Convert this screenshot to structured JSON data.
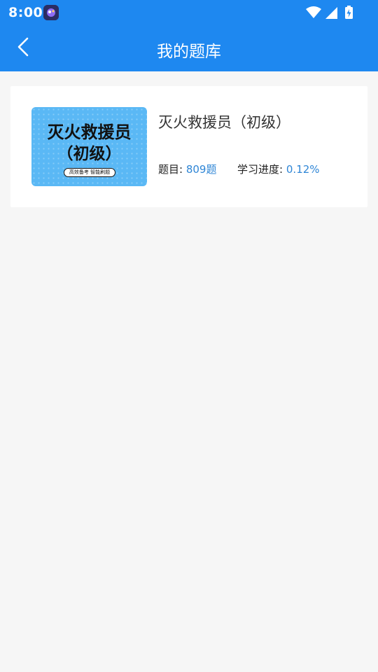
{
  "status_bar": {
    "time": "8:00",
    "icons": [
      "app-notification-icon",
      "wifi-icon",
      "cellular-signal-icon",
      "battery-charging-icon"
    ]
  },
  "header": {
    "title": "我的题库",
    "back_icon": "chevron-left-icon"
  },
  "question_banks": [
    {
      "title": "灭火救援员（初级）",
      "cover": {
        "line1": "灭火救援员",
        "line2": "（初级）",
        "tag": "高效备考 智能刷题"
      },
      "questions_label": "题目:",
      "questions_value": "809题",
      "progress_label": "学习进度:",
      "progress_value": "0.12%"
    }
  ],
  "colors": {
    "primary": "#1e88f0",
    "background": "#f6f6f6",
    "accent_text": "#2f86d6",
    "cover_background": "#5ab8f5"
  }
}
